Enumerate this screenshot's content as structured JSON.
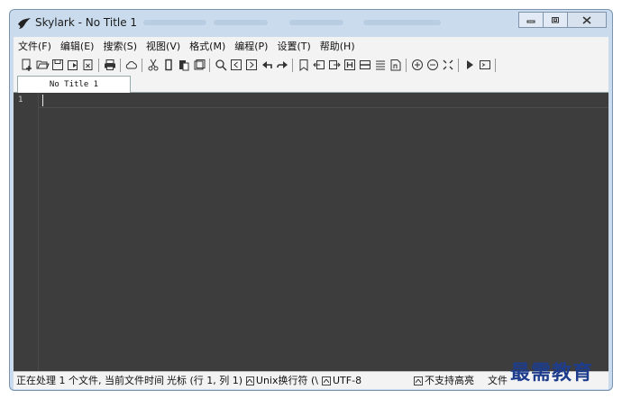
{
  "window": {
    "title": "Skylark - No Title 1",
    "icon": "bird-logo-icon"
  },
  "menu": [
    {
      "label": "文件(F)"
    },
    {
      "label": "编辑(E)"
    },
    {
      "label": "搜索(S)"
    },
    {
      "label": "视图(V)"
    },
    {
      "label": "格式(M)"
    },
    {
      "label": "编程(P)"
    },
    {
      "label": "设置(T)"
    },
    {
      "label": "帮助(H)"
    }
  ],
  "toolbar_icons": [
    "new-file-icon",
    "open-folder-icon",
    "save-icon",
    "save-all-icon",
    "close-file-icon",
    "sep",
    "print-icon",
    "sep",
    "cloud-icon",
    "sep",
    "cut-icon",
    "copy-icon",
    "paste-icon",
    "clipboard-icon",
    "sep",
    "find-icon",
    "find-prev-icon",
    "find-next-icon",
    "undo-icon",
    "redo-icon",
    "sep",
    "bookmark-icon",
    "indent-left-icon",
    "indent-right-icon",
    "hex-icon",
    "wrap-icon",
    "list-icon",
    "doc-map-icon",
    "sep",
    "zoom-in-icon",
    "zoom-out-icon",
    "fullscreen-icon",
    "sep",
    "run-icon",
    "console-icon",
    "sep"
  ],
  "tabs": [
    {
      "label": "No Title 1"
    }
  ],
  "editor": {
    "line_numbers": [
      "1"
    ]
  },
  "status": {
    "info": "正在处理 1 个文件, 当前文件时间",
    "cursor": "光标 (行 1, 列 1)",
    "eol": "Unix换行符 (\\",
    "encoding": "UTF-8",
    "highlight": "不支持高亮",
    "filetype": "文件"
  },
  "watermark": "最需教育",
  "colors": {
    "editor_bg": "#3d3d3d",
    "frame": "#c9dbec",
    "chrome": "#f3f3f3"
  }
}
